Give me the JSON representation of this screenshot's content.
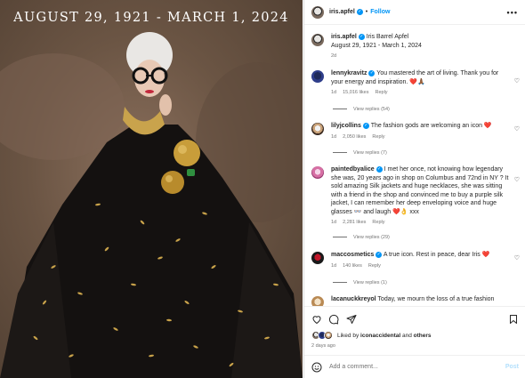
{
  "photo": {
    "caption": "AUGUST 29, 1921 - MARCH 1, 2024"
  },
  "header": {
    "username": "iris.apfel",
    "follow_label": "Follow",
    "more_label": "•••"
  },
  "caption_post": {
    "username": "iris.apfel",
    "name": "Iris Barrel Apfel",
    "text": "August 29, 1921 - March 1, 2024",
    "time": "2d"
  },
  "comments": [
    {
      "username": "lennykravitz",
      "text": "You mastered the art of living. Thank you for your energy and inspiration. ❤️🙏🏾",
      "time": "1d",
      "likes": "15,016 likes",
      "reply": "Reply",
      "replies": "View replies (54)"
    },
    {
      "username": "lilyjcollins",
      "text": "The fashion gods are welcoming an icon ❤️",
      "time": "1d",
      "likes": "2,050 likes",
      "reply": "Reply",
      "replies": "View replies (7)"
    },
    {
      "username": "paintedbyalice",
      "text": "I met her once, not knowing how legendary she was, 20 years ago in shop on Columbus and 72nd in NY ? It sold amazing Silk jackets and huge necklaces, she was sitting with a friend in the shop and convinced me to buy a purple silk jacket, I can remember her deep enveloping voice and huge glasses 👓 and laugh ❤️👌 xxx",
      "time": "1d",
      "likes": "2,281 likes",
      "reply": "Reply",
      "replies": "View replies (29)"
    },
    {
      "username": "maccosmetics",
      "text": "A true icon. Rest in peace, dear Iris ❤️",
      "time": "1d",
      "likes": "140 likes",
      "reply": "Reply",
      "replies": "View replies (1)"
    },
    {
      "username": "lacanuckkreyol",
      "text": "Today, we mourn the loss of a true fashion",
      "time": "",
      "likes": "",
      "reply": "",
      "replies": ""
    }
  ],
  "likes_row": {
    "prefix": "Liked by",
    "user": "iconaccidental",
    "and": "and",
    "others": "others"
  },
  "posted_ago": "2 days ago",
  "add_comment": {
    "placeholder": "Add a comment...",
    "post_label": "Post"
  }
}
